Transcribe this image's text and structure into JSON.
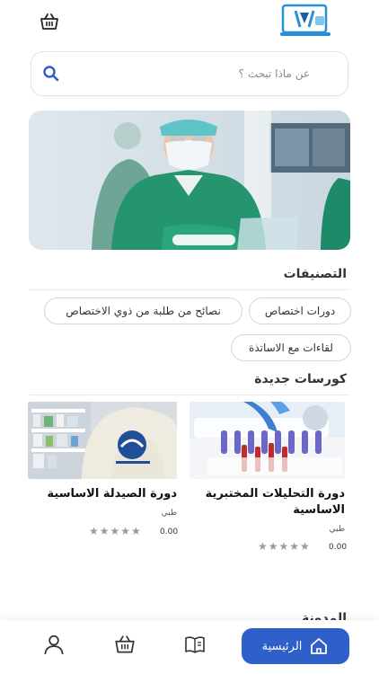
{
  "header": {
    "logo": "app-logo",
    "cart_icon": "basket-icon"
  },
  "search": {
    "placeholder": "عن ماذا تبحث ؟",
    "value": ""
  },
  "categories": {
    "title": "التصنيفات",
    "chips": [
      "دورات اختصاص",
      "نصائح من طلبة من ذوي الاختصاص",
      "لقاءات مع الاساتذة"
    ]
  },
  "new_courses": {
    "title": "كورسات جديدة",
    "courses": [
      {
        "title": "دورة التحليلات المختبرية الاساسية",
        "author": "طبي",
        "price": "0.00",
        "rating": 0
      },
      {
        "title": "دورة الصيدلة الاساسية",
        "author": "طبي",
        "price": "0.00",
        "rating": 0
      }
    ]
  },
  "blog": {
    "title": "المدونة"
  },
  "bottom_nav": {
    "home_label": "الرئيسية",
    "items": [
      "home-icon",
      "book-icon",
      "basket-icon",
      "profile-icon"
    ]
  },
  "colors": {
    "accent": "#2f5fc9",
    "logo_blue": "#2b8fd6"
  }
}
